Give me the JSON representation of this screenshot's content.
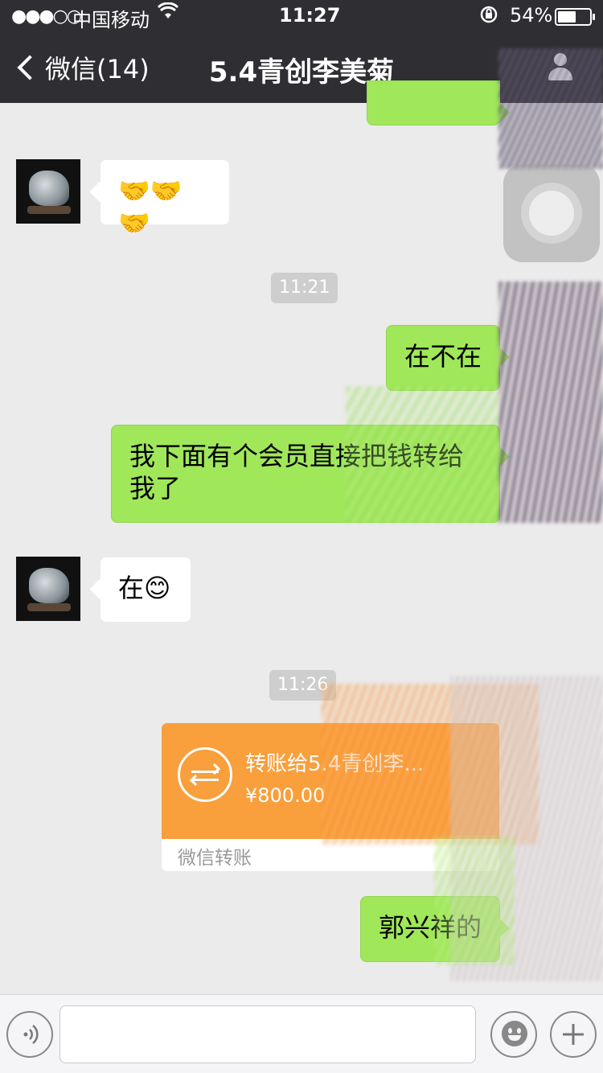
{
  "status_bar": {
    "signal": "●●●○○",
    "carrier": "中国移动",
    "time": "11:27",
    "battery_pct": "54%"
  },
  "nav": {
    "back_label": "微信(14)",
    "title": "5.4青创李美菊"
  },
  "messages": [
    {
      "side": "left",
      "text": "🤝🤝🤝"
    },
    {
      "type": "timestamp",
      "text": "11:21"
    },
    {
      "side": "right",
      "text": "在不在"
    },
    {
      "side": "right",
      "text": "我下面有个会员直接把钱转给我了"
    },
    {
      "side": "left",
      "text": "在😊"
    },
    {
      "type": "timestamp",
      "text": "11:26"
    },
    {
      "side": "right",
      "type": "transfer",
      "title": "转账给5.4青创李...",
      "amount": "¥800.00",
      "footer": "微信转账"
    },
    {
      "side": "right",
      "text": "郭兴祥的"
    }
  ],
  "colors": {
    "nav_bg": "#2f2f33",
    "chat_bg": "#ebebeb",
    "bubble_green": "#a0e75a",
    "transfer_orange": "#f99f3b"
  },
  "icons": {
    "back": "chevron-left-icon",
    "profile": "person-icon",
    "voice": "voice-icon",
    "emoji": "emoji-icon",
    "more": "plus-icon"
  }
}
